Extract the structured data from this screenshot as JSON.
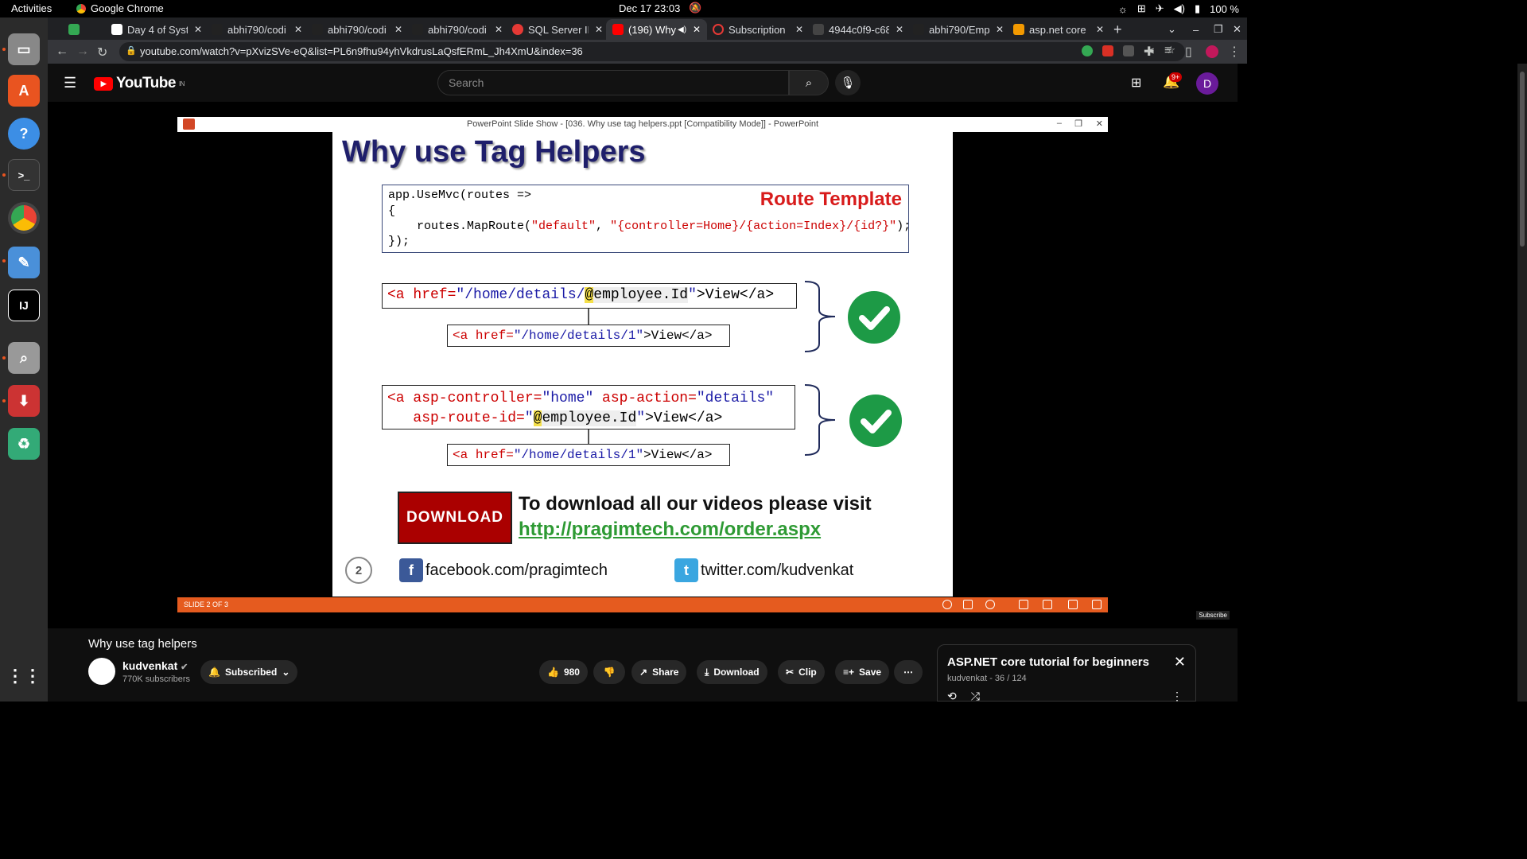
{
  "topbar": {
    "activities": "Activities",
    "app_name": "Google Chrome",
    "clock": "Dec 17  23:03",
    "battery": "100 %"
  },
  "tabs": [
    {
      "title": "",
      "active": false,
      "fav_color": "#34a853"
    },
    {
      "title": "Day 4 of Syst",
      "active": false,
      "fav_color": "#ffffff"
    },
    {
      "title": "abhi790/codi",
      "active": false,
      "fav_color": "#222222"
    },
    {
      "title": "abhi790/codi",
      "active": false,
      "fav_color": "#222222"
    },
    {
      "title": "abhi790/codi",
      "active": false,
      "fav_color": "#222222"
    },
    {
      "title": "SQL Server IN",
      "active": false,
      "fav_color": "#e53935"
    },
    {
      "title": "(196) Why",
      "active": true,
      "fav_color": "#ff0000"
    },
    {
      "title": "Subscription",
      "active": false,
      "fav_color": "#e53935"
    },
    {
      "title": "4944c0f9-c68",
      "active": false,
      "fav_color": "#444444"
    },
    {
      "title": "abhi790/Emp",
      "active": false,
      "fav_color": "#222222"
    },
    {
      "title": "asp.net core",
      "active": false,
      "fav_color": "#f29900"
    }
  ],
  "address": {
    "url": "youtube.com/watch?v=pXvizSVe-eQ&list=PL6n9fhu94yhVkdrusLaQsfERmL_Jh4XmU&index=36"
  },
  "youtube": {
    "logo": "YouTube",
    "region": "IN",
    "search_placeholder": "Search",
    "notif_count": "9+",
    "avatar_letter": "D"
  },
  "ppt": {
    "window_title": "PowerPoint Slide Show - [036. Why use tag helpers.ppt [Compatibility Mode]] - PowerPoint",
    "slide_title": "Why use Tag Helpers",
    "route_label": "Route Template",
    "route_line1": "app.UseMvc(routes =>",
    "route_line2": "{",
    "route_line3a": "    routes.MapRoute(",
    "route_line3b": "\"default\"",
    "route_line3c": ", ",
    "route_line3d": "\"{controller=Home}/{action=Index}/{id?}\"",
    "route_line3e": ");",
    "route_line4": "});",
    "ex1_tag": "<a ",
    "ex1_attr": "href=",
    "ex1_val_a": "\"/home/details/",
    "ex1_at": "@",
    "ex1_expr": "employee.Id",
    "ex1_val_b": "\"",
    "ex1_end": ">View</a>",
    "ex1_out_tag": "<a ",
    "ex1_out_attr": "href=",
    "ex1_out_val": "\"/home/details/1\"",
    "ex1_out_end": ">View</a>",
    "ex2_tag": "<a ",
    "ex2_attr1": "asp-controller=",
    "ex2_val1": "\"home\"",
    "ex2_attr2": " asp-action=",
    "ex2_val2": "\"details\"",
    "ex2_attr3": "   asp-route-id=",
    "ex2_val3a": "\"",
    "ex2_at": "@",
    "ex2_expr": "employee.Id",
    "ex2_val3b": "\"",
    "ex2_end": ">View</a>",
    "ex2_out_tag": "<a ",
    "ex2_out_attr": "href=",
    "ex2_out_val": "\"/home/details/1\"",
    "ex2_out_end": ">View</a>",
    "download_button": "DOWNLOAD",
    "download_text": "To download all our videos please visit",
    "download_link": "http://pragimtech.com/order.aspx",
    "slide_number": "2",
    "facebook": "facebook.com/pragimtech",
    "twitter": "twitter.com/kudvenkat",
    "status": "SLIDE 2 OF 3",
    "watermark": "Subscribe"
  },
  "video": {
    "title": "Why use tag helpers",
    "channel": "kudvenkat",
    "subscribers": "770K subscribers",
    "subscribed_label": "Subscribed",
    "likes": "980",
    "share": "Share",
    "download": "Download",
    "clip": "Clip",
    "save": "Save"
  },
  "playlist": {
    "title": "ASP.NET core tutorial for beginners",
    "meta": "kudvenkat - 36 / 124"
  },
  "colors": {
    "youtube_red": "#ff0000",
    "ppt_status": "#e55b1f",
    "check_green": "#1d9a46",
    "link_green": "#2e9a34"
  }
}
